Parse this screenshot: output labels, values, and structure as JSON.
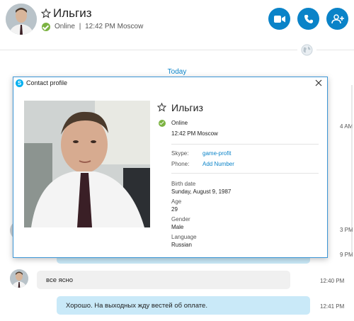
{
  "header": {
    "name": "Ильгиз",
    "status": "Online",
    "separator": "|",
    "local_time": "12:42 PM Moscow",
    "buttons": {
      "video": "video-call-icon",
      "call": "phone-icon",
      "add": "add-person-icon"
    }
  },
  "chat": {
    "day_label": "Today",
    "messages": [
      {
        "direction": "in",
        "text": "все ясно",
        "time": "12:40 PM"
      },
      {
        "direction": "out",
        "text": "Хорошо. На выходных жду вестей об оплате.",
        "time": "12:41 PM"
      }
    ],
    "partial_times": [
      "4 AM",
      "3 PM",
      "9 PM"
    ]
  },
  "dialog": {
    "title": "Contact profile",
    "name": "Ильгиз",
    "status": "Online",
    "local_time": "12:42 PM Moscow",
    "skype_label": "Skype:",
    "skype_value": "game-profit",
    "phone_label": "Phone:",
    "phone_value": "Add Number",
    "birth_label": "Birth date",
    "birth_value": "Sunday, August 9, 1987",
    "age_label": "Age",
    "age_value": "29",
    "gender_label": "Gender",
    "gender_value": "Male",
    "language_label": "Language",
    "language_value": "Russian"
  },
  "colors": {
    "accent": "#0a83c8",
    "online": "#7cb342",
    "bubble_out": "#c9e9f8",
    "bubble_in": "#f0f0f0"
  }
}
